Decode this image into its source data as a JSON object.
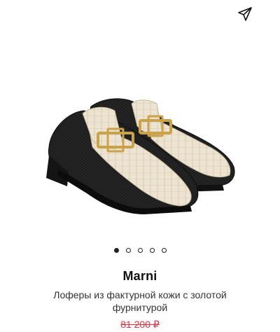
{
  "header": {
    "share_icon": "share-icon"
  },
  "gallery": {
    "image_alt": "product-photo-loafers",
    "dots_count": 5,
    "active_index": 0
  },
  "product": {
    "brand": "Marni",
    "title": "Лоферы из фактурной кожи с золотой фурнитурой",
    "price_old": "81 200 ₽",
    "price_color": "#e0313f"
  },
  "colors": {
    "leather_black": "#1a1a1a",
    "croc_cream": "#ece3d0",
    "hardware_gold": "#c9a24a"
  }
}
